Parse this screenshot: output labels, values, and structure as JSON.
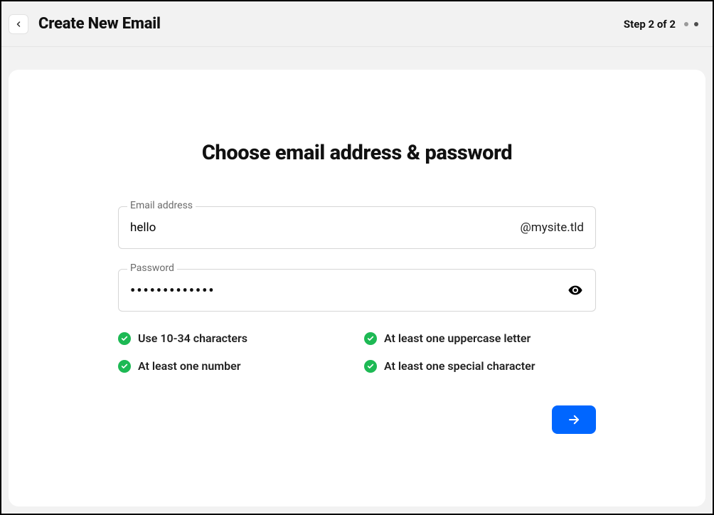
{
  "header": {
    "title": "Create New Email",
    "step_label": "Step 2 of 2"
  },
  "card": {
    "title": "Choose email address & password"
  },
  "email": {
    "label": "Email address",
    "value": "hello",
    "domain": "@mysite.tld"
  },
  "password": {
    "label": "Password",
    "masked": "•••••••••••••"
  },
  "rules": [
    "Use 10-34 characters",
    "At least one uppercase letter",
    "At least one number",
    "At least one special character"
  ]
}
